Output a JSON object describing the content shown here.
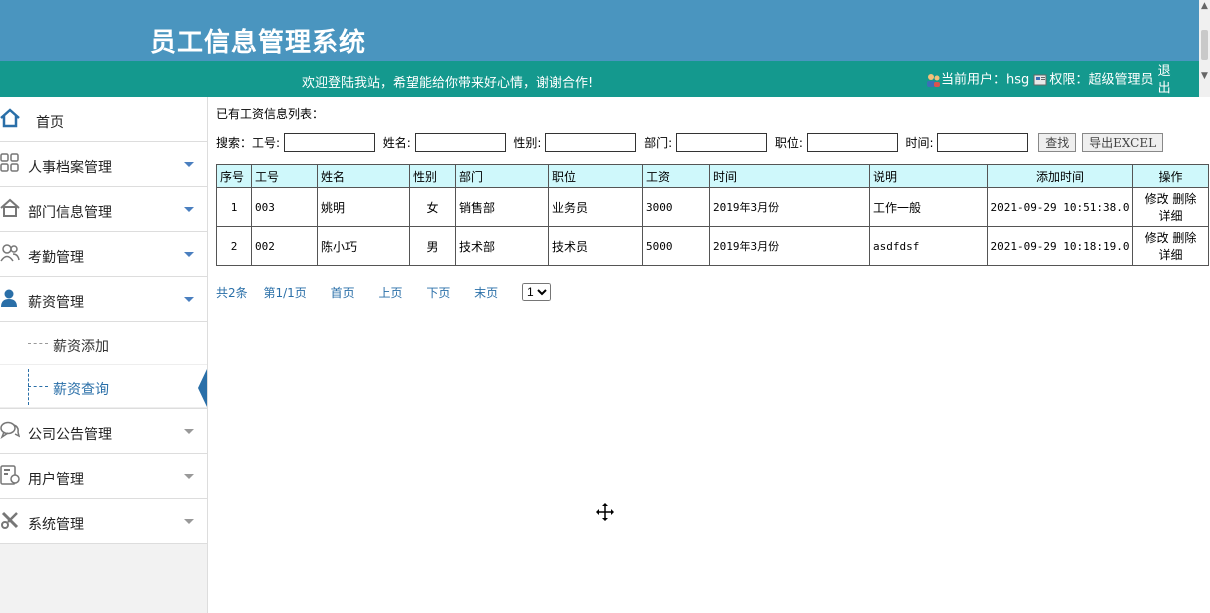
{
  "header": {
    "title": "员工信息管理系统"
  },
  "topbar": {
    "welcome": "欢迎登陆我站，希望能给你带来好心情，谢谢合作!",
    "current_user_label": "当前用户：",
    "current_user": "hsg",
    "permission_label": "权限：",
    "permission": "超级管理员",
    "logout": "退出"
  },
  "sidebar": {
    "home": "首页",
    "items": [
      {
        "label": "人事档案管理"
      },
      {
        "label": "部门信息管理"
      },
      {
        "label": "考勤管理"
      },
      {
        "label": "薪资管理"
      }
    ],
    "sub_items": [
      {
        "label": "薪资添加"
      },
      {
        "label": "薪资查询"
      }
    ],
    "more_items": [
      {
        "label": "公司公告管理"
      },
      {
        "label": "用户管理"
      },
      {
        "label": "系统管理"
      }
    ]
  },
  "content": {
    "list_title": "已有工资信息列表：",
    "search": {
      "label": "搜索：",
      "emp_id": "工号:",
      "name": "姓名:",
      "gender": "性别:",
      "dept": "部门:",
      "position": "职位:",
      "time": "时间:",
      "find_btn": "查找",
      "export_btn": "导出EXCEL"
    },
    "table": {
      "headers": [
        "序号",
        "工号",
        "姓名",
        "性别",
        "部门",
        "职位",
        "工资",
        "时间",
        "说明",
        "添加时间",
        "操作"
      ],
      "rows": [
        {
          "no": "1",
          "emp_id": "003",
          "name": "姚明",
          "gender": "女",
          "dept": "销售部",
          "position": "业务员",
          "salary": "3000",
          "time": "2019年3月份",
          "note": "工作一般",
          "added": "2021-09-29 10:51:38.0"
        },
        {
          "no": "2",
          "emp_id": "002",
          "name": "陈小巧",
          "gender": "男",
          "dept": "技术部",
          "position": "技术员",
          "salary": "5000",
          "time": "2019年3月份",
          "note": "asdfdsf",
          "added": "2021-09-29 10:18:19.0"
        }
      ],
      "op_edit": "修改",
      "op_delete": "删除",
      "op_detail": "详细"
    },
    "pager": {
      "total": "共2条",
      "page": "第1/1页",
      "first": "首页",
      "prev": "上页",
      "next": "下页",
      "last": "末页",
      "select_value": "1"
    }
  },
  "colors": {
    "header_blue": "#4a95bf",
    "bar_green": "#14998e",
    "table_header": "#cff8fb",
    "link_blue": "#2a6fa8"
  }
}
